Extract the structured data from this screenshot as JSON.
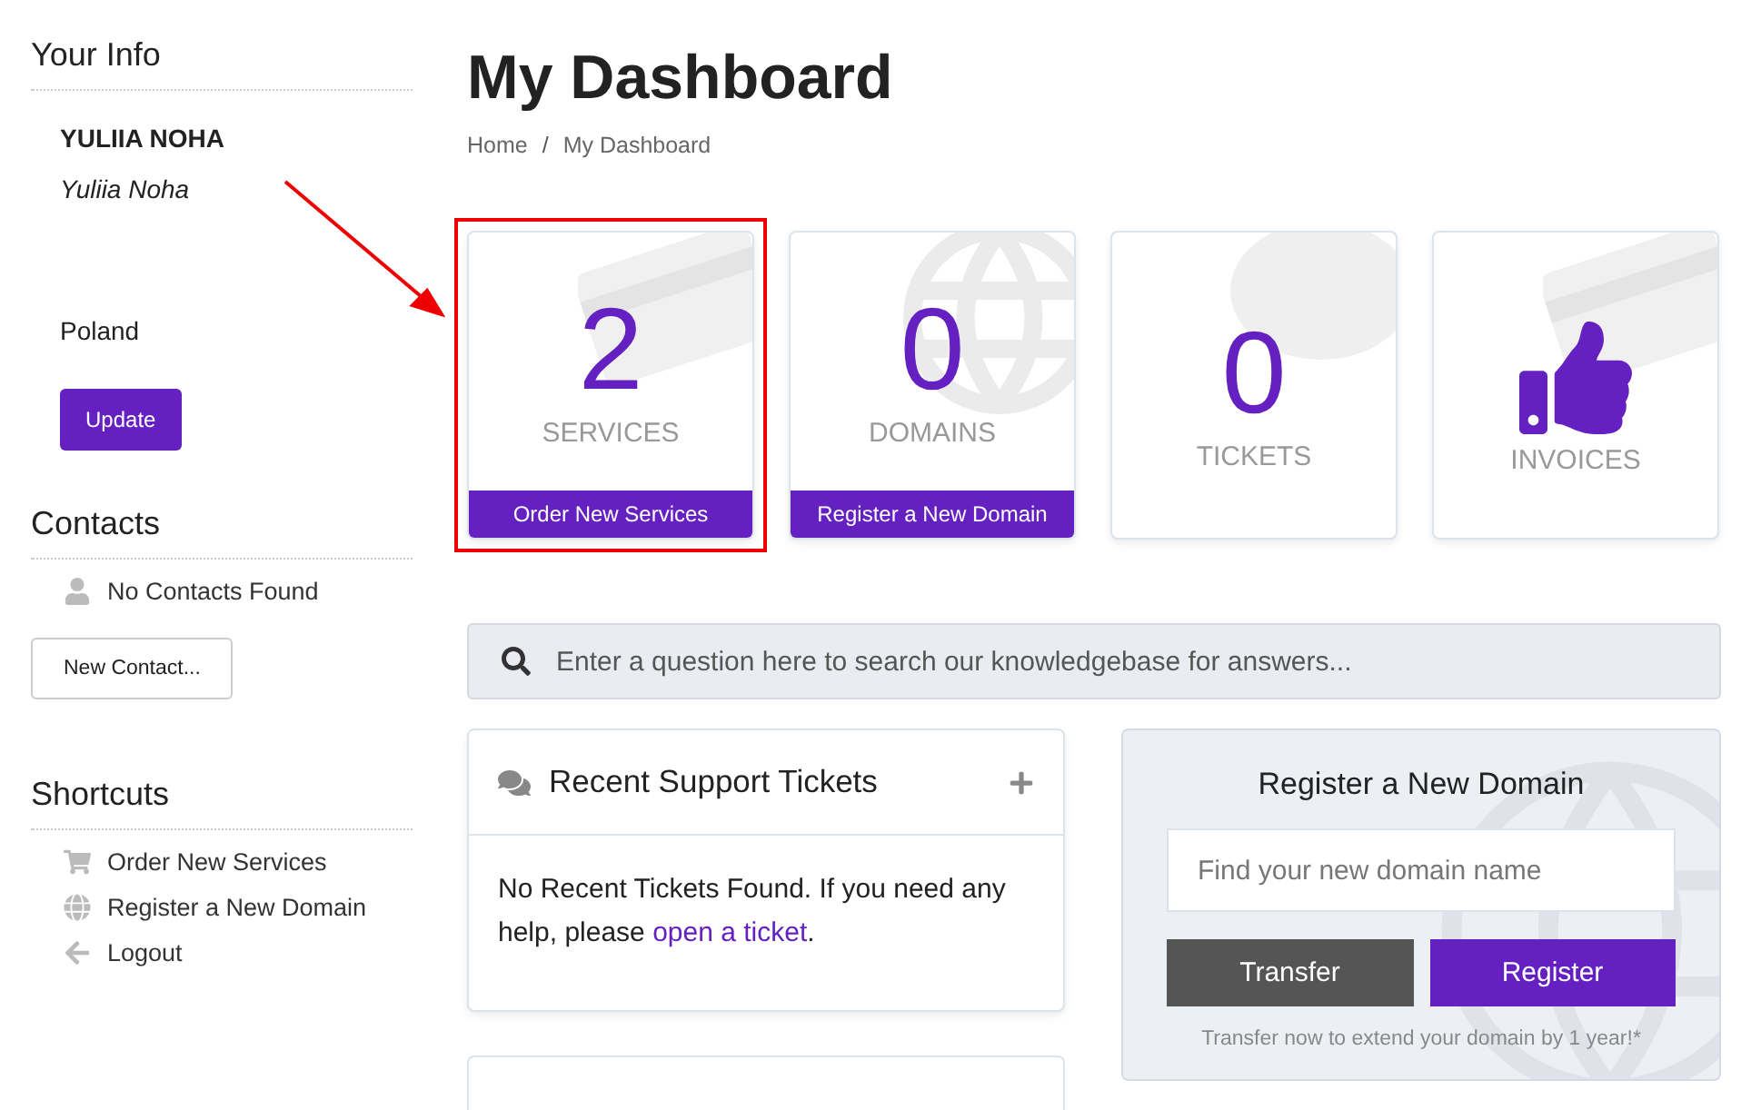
{
  "sidebar": {
    "your_info": {
      "heading": "Your Info",
      "name": "YULIIA NOHA",
      "full_name": "Yuliia Noha",
      "country": "Poland",
      "button": "Update"
    },
    "contacts": {
      "heading": "Contacts",
      "empty": "No Contacts Found",
      "button": "New Contact..."
    },
    "shortcuts": {
      "heading": "Shortcuts",
      "items": [
        {
          "label": "Order New Services"
        },
        {
          "label": "Register a New Domain"
        },
        {
          "label": "Logout"
        }
      ]
    }
  },
  "page": {
    "title": "My Dashboard",
    "breadcrumb": [
      "Home",
      "My Dashboard"
    ],
    "separator": "/"
  },
  "tiles": [
    {
      "kind": "count",
      "value": "2",
      "label": "SERVICES",
      "action": "Order New Services",
      "highlighted": true
    },
    {
      "kind": "count",
      "value": "0",
      "label": "DOMAINS",
      "action": "Register a New Domain",
      "highlighted": false
    },
    {
      "kind": "count",
      "value": "0",
      "label": "TICKETS",
      "highlighted": false
    },
    {
      "kind": "icon",
      "label": "INVOICES",
      "highlighted": false
    }
  ],
  "search": {
    "placeholder": "Enter a question here to search our knowledgebase for answers..."
  },
  "tickets_panel": {
    "title": "Recent Support Tickets",
    "text": "No Recent Tickets Found. If you need any help, please ",
    "link": "open a ticket",
    "after": "."
  },
  "domain_panel": {
    "title": "Register a New Domain",
    "placeholder": "Find your new domain name",
    "transfer": "Transfer",
    "register": "Register",
    "note": "Transfer now to extend your domain by 1 year!*"
  }
}
